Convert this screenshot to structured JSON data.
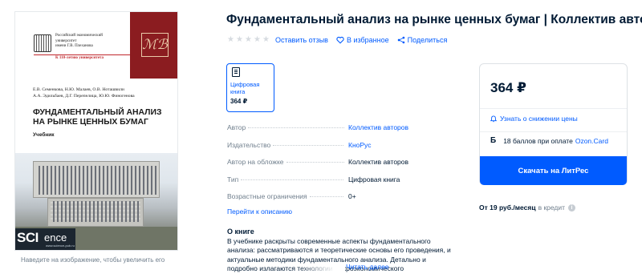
{
  "cover": {
    "publisher_lines": [
      "Российский экономический",
      "университет",
      "имени Г.В. Плеханова"
    ],
    "publisher_sub": "К 110-летию университета",
    "authors_line1": "Е.В. Семенкова, Н.Ю. Малаев, О.В. Ноташвили",
    "authors_line2": "А.А. Эдильбаев, Д.Г. Перепелица, Ю.Ю. Финогенова",
    "title_line1": "ФУНДАМЕНТАЛЬНЫЙ АНАЛИЗ",
    "title_line2": "НА РЫНКЕ ЦЕННЫХ БУМАГ",
    "subtitle": "Учебник",
    "brand_sci": "SCI",
    "brand_ence": "ence",
    "brand_url": "www.science-pub.ru",
    "zoom_hint": "Наведите на изображение, чтобы увеличить его"
  },
  "product": {
    "title": "Фундаментальный анализ на рынке ценных бумаг | Коллектив авторов",
    "stars": 5,
    "review_label": "Оставить отзыв",
    "favorite_label": "В избранное",
    "share_label": "Поделиться"
  },
  "format": {
    "label": "Цифровая книга",
    "price": "364 ₽"
  },
  "specs": [
    {
      "label": "Автор",
      "value": "Коллектив авторов",
      "link": true
    },
    {
      "label": "Издательство",
      "value": "КноРус",
      "link": true
    },
    {
      "label": "Автор на обложке",
      "value": "Коллектив авторов",
      "link": false
    },
    {
      "label": "Тип",
      "value": "Цифровая книга",
      "link": false
    },
    {
      "label": "Возрастные ограничения",
      "value": "0+",
      "link": false
    }
  ],
  "goto_description": "Перейти к описанию",
  "about": {
    "heading": "О книге",
    "text": "В учебнике раскрыты современные аспекты фундаментального анализа: рассматриваются и теоретические основы его проведения, и актуальные методики фундаментального анализа. Детально и подробно излагаются технологии макроэкономического",
    "read_more": "Читать далее"
  },
  "price_card": {
    "price": "364 ₽",
    "notify_label": "Узнать о снижении цены",
    "bonus_icon": "Б",
    "bonus_text": "18 баллов при оплате",
    "bonus_card": "Ozon.Card",
    "buy_label": "Скачать на ЛитРес",
    "credit_amount": "От 19 руб./месяц",
    "credit_text": "в кредит"
  },
  "colors": {
    "accent": "#005bff",
    "text": "#001a34",
    "muted": "#707f8d",
    "cover_red": "#8b1c20"
  }
}
